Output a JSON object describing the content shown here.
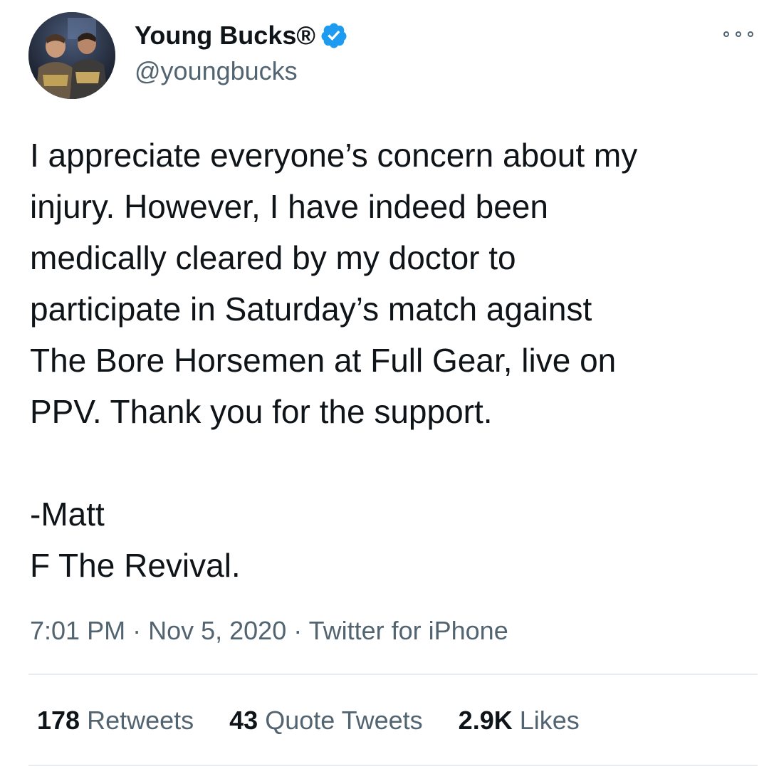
{
  "author": {
    "display_name": "Young Bucks®",
    "handle": "@youngbucks",
    "verified": true,
    "verified_color": "#1d9bf0"
  },
  "tweet": {
    "text": "I appreciate everyone’s concern about my\ninjury. However, I have indeed been\nmedically cleared by my doctor to\nparticipate in Saturday’s match against\nThe Bore Horsemen at Full Gear, live on\nPPV. Thank you for the support.\n\n-Matt\nF The Revival.",
    "time": "7:01 PM",
    "date": "Nov 5, 2020",
    "separator": "·",
    "source": "Twitter for iPhone"
  },
  "stats": {
    "retweets_count": "178",
    "retweets_label": "Retweets",
    "quotes_count": "43",
    "quotes_label": "Quote Tweets",
    "likes_count": "2.9K",
    "likes_label": "Likes"
  },
  "icons": {
    "more": "more-options-icon",
    "verified": "verified-badge-icon"
  }
}
